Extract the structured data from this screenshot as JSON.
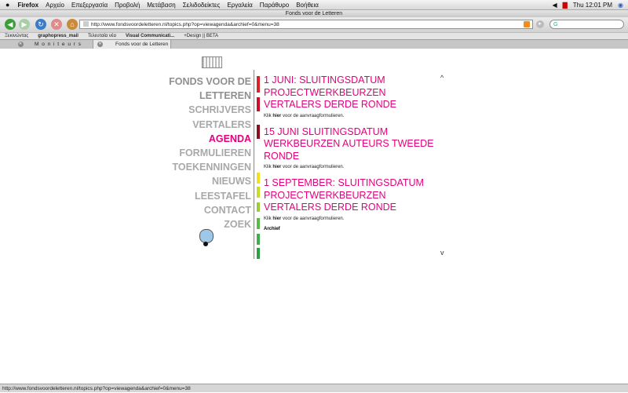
{
  "mac_menu": {
    "apple": "",
    "items": [
      "Firefox",
      "Αρχείο",
      "Επεξεργασία",
      "Προβολή",
      "Μετάβαση",
      "Σελιδοδείκτες",
      "Εργαλεία",
      "Παράθυρο",
      "Βοήθεια"
    ],
    "clock": "Thu 12:01 PM"
  },
  "window": {
    "title": "Fonds voor de Letteren"
  },
  "navbar": {
    "url": "http://www.fondsvoordeletteren.nl/topics.php?op=viewagenda&archief=0&menu=38",
    "search_value": "G"
  },
  "bookmarks": [
    "Ξεκινώντας",
    "graphopress_mail",
    "Τελευταία νέα",
    "Visual Communicati...",
    "+Design || BETA"
  ],
  "tabs": [
    "M o n i t e u r s",
    "Fonds voor de Letteren"
  ],
  "site": {
    "name_line1": "FONDS VOOR DE",
    "name_line2": "LETTEREN",
    "menu": [
      "SCHRIJVERS",
      "VERTALERS",
      "AGENDA",
      "FORMULIEREN",
      "TOEKENNINGEN",
      "NIEUWS",
      "LEESTAFEL",
      "CONTACT",
      "ZOEK"
    ]
  },
  "agenda": {
    "events": [
      {
        "title": "1 JUNI: SLUITINGSDATUM PROJECTWERKBEURZEN VERTALERS DERDE RONDE",
        "note_pre": "Klik ",
        "note_link": "hier",
        "note_post": " voor de aanvraagformulieren."
      },
      {
        "title": "15 JUNI SLUITINGSDATUM WERKBEURZEN AUTEURS TWEEDE RONDE",
        "note_pre": "Klik ",
        "note_link": "hier",
        "note_post": " voor de aanvraagformulieren."
      },
      {
        "title": "1 SEPTEMBER: SLUITINGSDATUM PROJECTWERKBEURZEN VERTALERS DERDE RONDE",
        "note_pre": "Klik ",
        "note_link": "hier",
        "note_post": " voor de aanvraagformulieren."
      }
    ],
    "archive_link": "Archief",
    "scroll_up": "^",
    "scroll_down": "v"
  },
  "status": {
    "text": "http://www.fondsvoordeletteren.nl/topics.php?op=viewagenda&archief=0&menu=38"
  },
  "colors": {
    "accent": "#e5007d",
    "menu_grey": "#a8a8a8"
  }
}
